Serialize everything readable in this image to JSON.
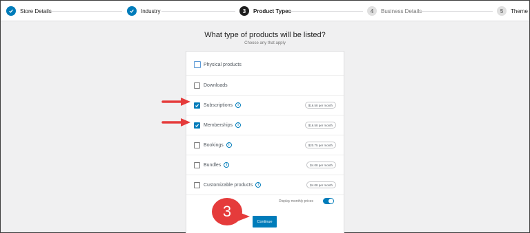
{
  "stepper": {
    "steps": [
      {
        "label": "Store Details",
        "state": "done",
        "marker": ""
      },
      {
        "label": "Industry",
        "state": "done",
        "marker": ""
      },
      {
        "label": "Product Types",
        "state": "current",
        "marker": "3"
      },
      {
        "label": "Business Details",
        "state": "todo",
        "marker": "4"
      },
      {
        "label": "Theme",
        "state": "todo",
        "marker": "5"
      }
    ]
  },
  "main": {
    "title": "What type of products will be listed?",
    "subtitle": "Choose any that apply"
  },
  "products": [
    {
      "label": "Physical products",
      "checked": false,
      "info": false,
      "price": ""
    },
    {
      "label": "Downloads",
      "checked": false,
      "info": false,
      "price": ""
    },
    {
      "label": "Subscriptions",
      "checked": true,
      "info": true,
      "price": "$16.58 per month"
    },
    {
      "label": "Memberships",
      "checked": true,
      "info": true,
      "price": "$16.58 per month"
    },
    {
      "label": "Bookings",
      "checked": false,
      "info": true,
      "price": "$20.75 per month"
    },
    {
      "label": "Bundles",
      "checked": false,
      "info": true,
      "price": "$4.08 per month"
    },
    {
      "label": "Customizable products",
      "checked": false,
      "info": true,
      "price": "$4.08 per month"
    }
  ],
  "footer": {
    "monthly_label": "Display monthly prices",
    "monthly_enabled": true,
    "continue_label": "Continue"
  },
  "annotation": {
    "badge_text": "3",
    "color": "#e53b3b"
  },
  "colors": {
    "accent": "#007cba",
    "current_step": "#1e1e1e",
    "page_bg": "#f0f0f1"
  },
  "icons": {
    "done_step": "check-icon",
    "info": "info-icon",
    "checkbox": "check-icon"
  }
}
